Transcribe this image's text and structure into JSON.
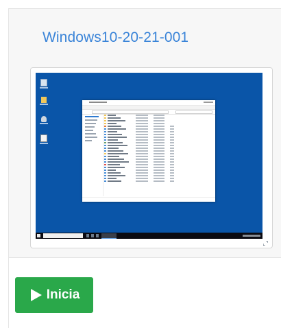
{
  "card": {
    "vm_name": "Windows10-20-21-001",
    "thumbnail_icon": "windows-desktop-screenshot",
    "expand_icon": "expand-icon"
  },
  "actions": {
    "start_label": "Inicia",
    "start_icon": "play-icon",
    "start_color": "#2aa84a"
  },
  "colors": {
    "title": "#3a84d8",
    "desktop_background": "#0a55a8"
  }
}
